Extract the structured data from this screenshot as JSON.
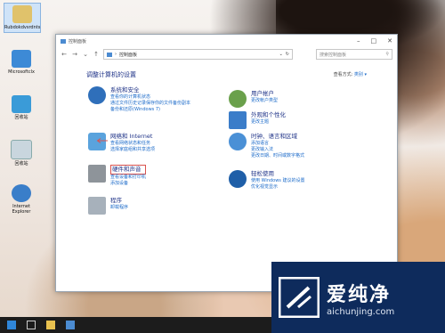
{
  "desktop": {
    "icons": [
      {
        "label": "Rubdokdvsrdnts"
      },
      {
        "label": "Microsoftclx"
      },
      {
        "label": "回收站"
      },
      {
        "label": "回收站"
      },
      {
        "label": "Internet Explorer"
      }
    ]
  },
  "window": {
    "title": "控制面板",
    "address": "控制面板",
    "search_placeholder": "搜索控制面板",
    "heading": "调整计算机的设置",
    "view_by_label": "查看方式:",
    "view_by_value": "类别 ▾",
    "categories_left": [
      {
        "title": "系统和安全",
        "links": [
          "查看你的计算机状态",
          "通过文件历史记录保存你的文件备份副本",
          "备份和还原(Windows 7)"
        ]
      },
      {
        "title": "网络和 Internet",
        "links": [
          "查看网络状态和任务",
          "选择家庭组和共享选项"
        ]
      },
      {
        "title": "硬件和声音",
        "links": [
          "查看设备和打印机",
          "添加设备"
        ]
      },
      {
        "title": "程序",
        "links": [
          "卸载程序"
        ]
      }
    ],
    "categories_right": [
      {
        "title": "用户帐户",
        "links": [
          "更改帐户类型"
        ]
      },
      {
        "title": "外观和个性化",
        "links": [
          "更改主题"
        ]
      },
      {
        "title": "时钟、语言和区域",
        "links": [
          "添加语言",
          "更改输入法",
          "更改日期、时间或数字格式"
        ]
      },
      {
        "title": "轻松使用",
        "links": [
          "使用 Windows 建议的设置",
          "优化视觉显示"
        ]
      }
    ]
  },
  "watermark": {
    "name": "爱纯净",
    "url": "aichunjing.com"
  },
  "colors": {
    "link_blue": "#1b6ac9",
    "heading_blue": "#1e3287",
    "watermark_bg": "#0e2b5c",
    "highlight_red": "#d9534f"
  }
}
